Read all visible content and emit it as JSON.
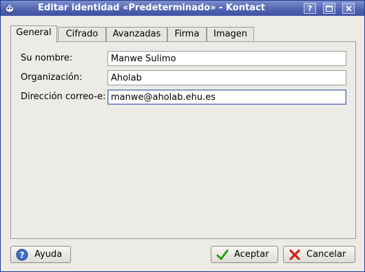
{
  "window": {
    "title": "Editar identidad «Predeterminado» - Kontact",
    "buttons": {
      "help": "?",
      "maximize": "□",
      "close": "✕"
    }
  },
  "tabs": [
    {
      "label": "General",
      "active": true
    },
    {
      "label": "Cifrado",
      "active": false
    },
    {
      "label": "Avanzadas",
      "active": false
    },
    {
      "label": "Firma",
      "active": false
    },
    {
      "label": "Imagen",
      "active": false
    }
  ],
  "form": {
    "name_label": "Su nombre:",
    "name_value": "Manwe Sulimo",
    "org_label": "Organización:",
    "org_value": "Aholab",
    "email_label": "Dirección correo-e:",
    "email_value": "manwe@aholab.ehu.es"
  },
  "footer": {
    "help_label": "Ayuda",
    "ok_label": "Aceptar",
    "cancel_label": "Cancelar"
  },
  "colors": {
    "titlebar": "#4f62b0",
    "accent_ok": "#2a9a1a",
    "accent_cancel": "#d0201a"
  }
}
